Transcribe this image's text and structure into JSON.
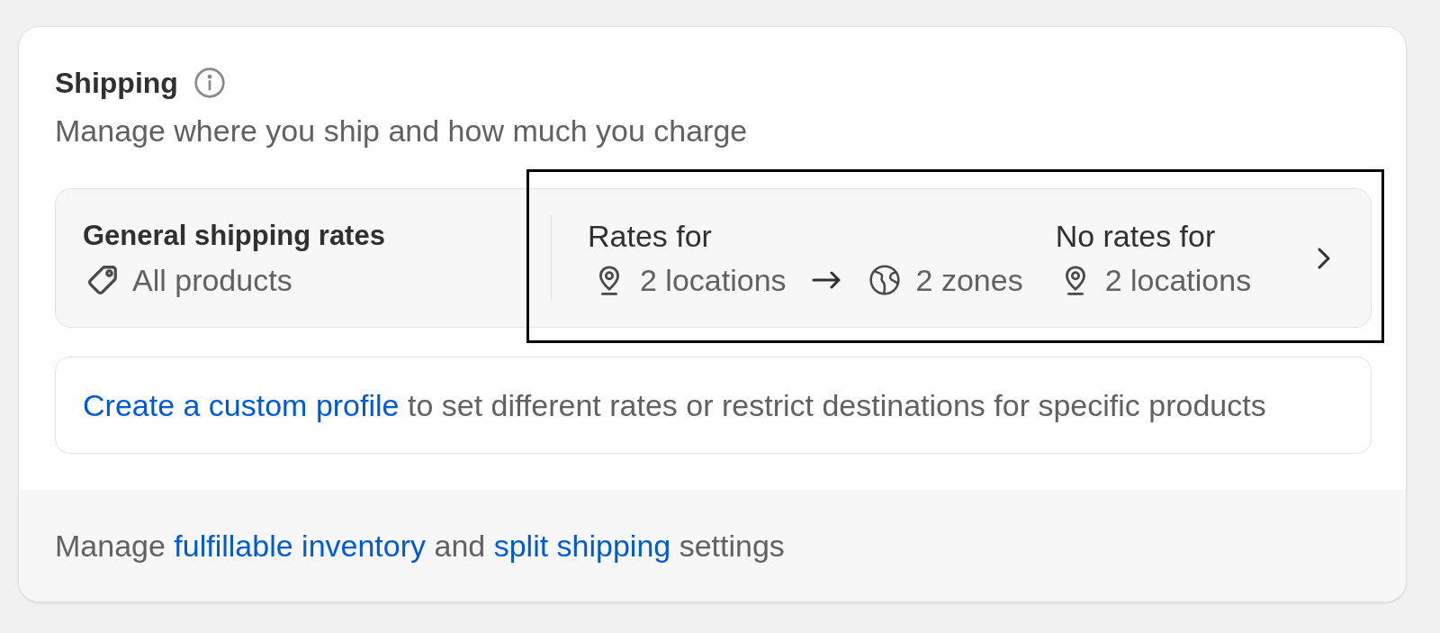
{
  "section": {
    "title": "Shipping",
    "description": "Manage where you ship and how much you charge"
  },
  "shipping_profile": {
    "name": "General shipping rates",
    "scope": "All products",
    "highlighted": true,
    "rates_for": {
      "label": "Rates for",
      "origin": "2 locations",
      "destination": "2 zones"
    },
    "no_rates_for": {
      "label": "No rates for",
      "destination": "2 locations"
    }
  },
  "custom_profile_notice": {
    "parts": [
      {
        "kind": "link",
        "text": "Create a custom profile"
      },
      {
        "kind": "text",
        "text": "to set different rates or restrict destinations for specific products"
      }
    ]
  },
  "footer": {
    "parts": [
      {
        "kind": "text",
        "text": "Manage"
      },
      {
        "kind": "link",
        "text": "fulfillable inventory"
      },
      {
        "kind": "text",
        "text": "and"
      },
      {
        "kind": "link",
        "text": "split shipping"
      },
      {
        "kind": "text",
        "text": "settings"
      }
    ]
  }
}
